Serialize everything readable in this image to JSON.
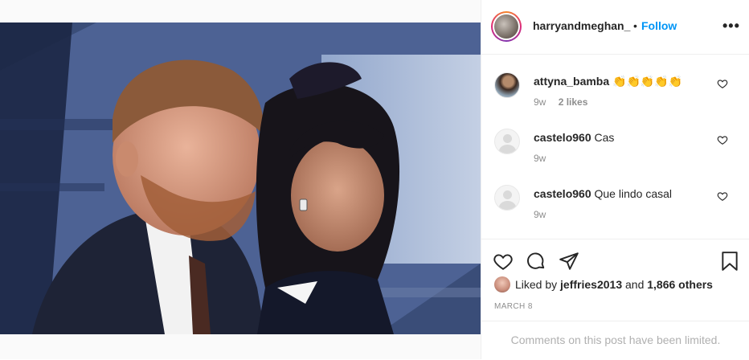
{
  "post": {
    "photo_alt": "",
    "author": {
      "username": "harryandmeghan_",
      "separator": "•",
      "follow_label": "Follow",
      "more_label": "•••"
    },
    "comments": [
      {
        "username": "attyna_bamba",
        "text": "👏👏👏👏👏",
        "time": "9w",
        "likes": "2 likes",
        "avatar": "photo"
      },
      {
        "username": "castelo960",
        "text": "Cas",
        "time": "9w",
        "avatar": "default"
      },
      {
        "username": "castelo960",
        "text": "Que lindo casal",
        "time": "9w",
        "avatar": "default"
      }
    ],
    "liked_by": {
      "prefix": "Liked by",
      "user": "jeffries2013",
      "joiner": "and",
      "others": "1,866 others"
    },
    "date": "MARCH 8",
    "comments_limited": "Comments on this post have been limited."
  },
  "icons": [
    "heart-icon",
    "comment-icon",
    "share-icon",
    "bookmark-icon",
    "more-icon"
  ],
  "colors": {
    "link": "#0095f6",
    "text": "#262626",
    "muted": "#8e8e8e",
    "border": "#efefef"
  }
}
